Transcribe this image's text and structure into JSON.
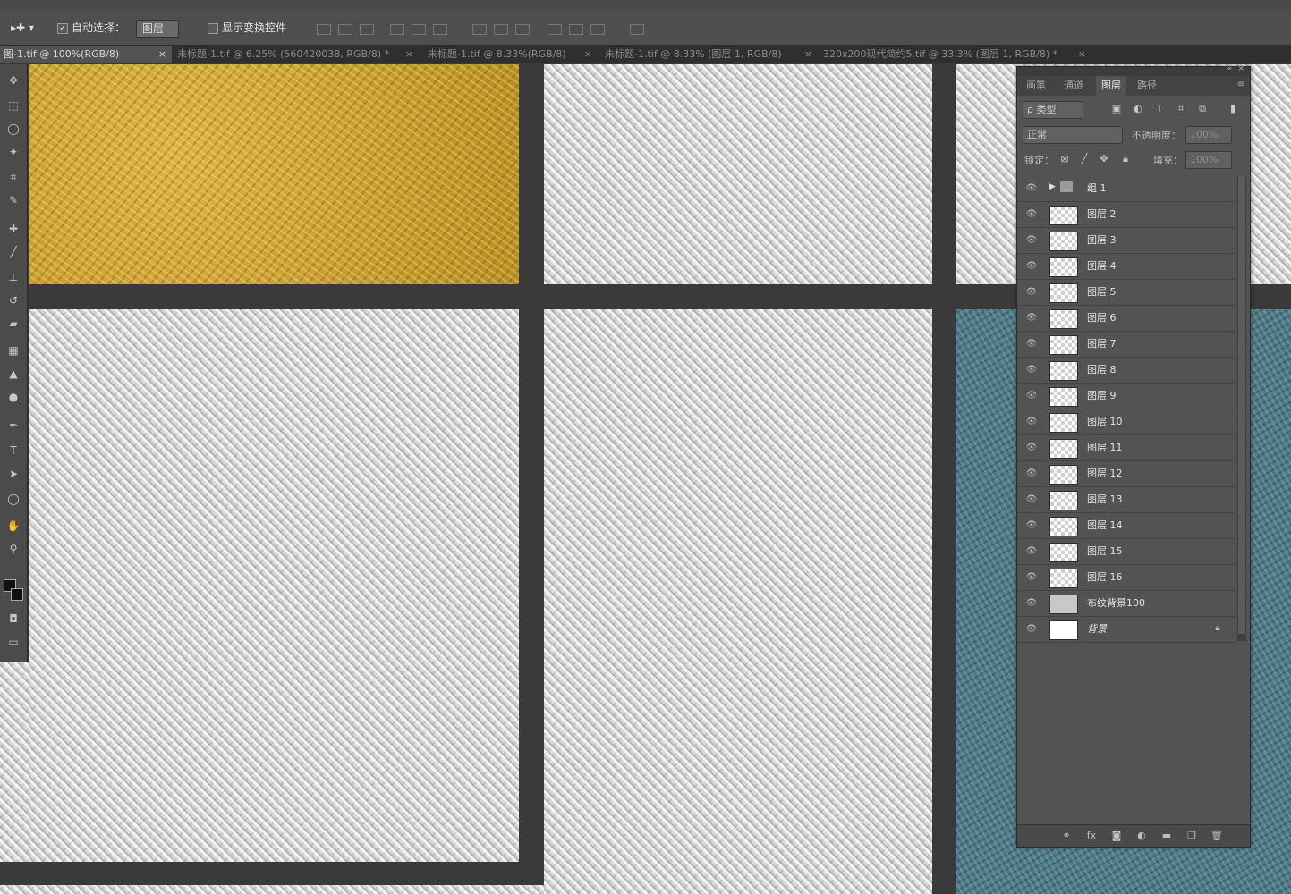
{
  "options": {
    "auto_select_label": "自动选择：",
    "auto_select_value": "图层",
    "show_transform_label": "显示变换控件"
  },
  "tabs": [
    "图-1.tif @ 100%(RGB/8)",
    "未标题-1.tif @ 6.25% (560420038, RGB/8) *",
    "未标题-1.tif @ 8.33%(RGB/8)",
    "未标题-1.tif @ 8.33% (图层 1, RGB/8)",
    "320x200现代简约5.tif @ 33.3% (图层 1, RGB/8) *"
  ],
  "tab_close": "×",
  "panel": {
    "tabs": [
      "画笔",
      "通道",
      "图层",
      "路径"
    ],
    "kind_filter": "ρ 类型",
    "blend_mode": "正常",
    "opacity_label": "不透明度：",
    "opacity_value": "100%",
    "lock_label": "锁定：",
    "fill_label": "填充：",
    "fill_value": "100%"
  },
  "layers": [
    {
      "name": "组 1",
      "type": "group"
    },
    {
      "name": "图层 2",
      "type": "layer"
    },
    {
      "name": "图层 3",
      "type": "layer"
    },
    {
      "name": "图层 4",
      "type": "layer"
    },
    {
      "name": "图层 5",
      "type": "layer"
    },
    {
      "name": "图层 6",
      "type": "layer"
    },
    {
      "name": "图层 7",
      "type": "layer"
    },
    {
      "name": "图层 8",
      "type": "layer"
    },
    {
      "name": "图层 9",
      "type": "layer"
    },
    {
      "name": "图层 10",
      "type": "layer"
    },
    {
      "name": "图层 11",
      "type": "layer"
    },
    {
      "name": "图层 12",
      "type": "layer"
    },
    {
      "name": "图层 13",
      "type": "layer"
    },
    {
      "name": "图层 14",
      "type": "layer"
    },
    {
      "name": "图层 15",
      "type": "layer"
    },
    {
      "name": "图层 16",
      "type": "layer"
    },
    {
      "name": "布纹背景100",
      "type": "fill"
    },
    {
      "name": "背景",
      "type": "background",
      "locked": true
    }
  ],
  "colors": {
    "gold_tile": "#c9a22f",
    "knit_tile": "#d9d9d9",
    "teal_tile": "#4e7a86",
    "workspace": "#3a3a3a"
  }
}
